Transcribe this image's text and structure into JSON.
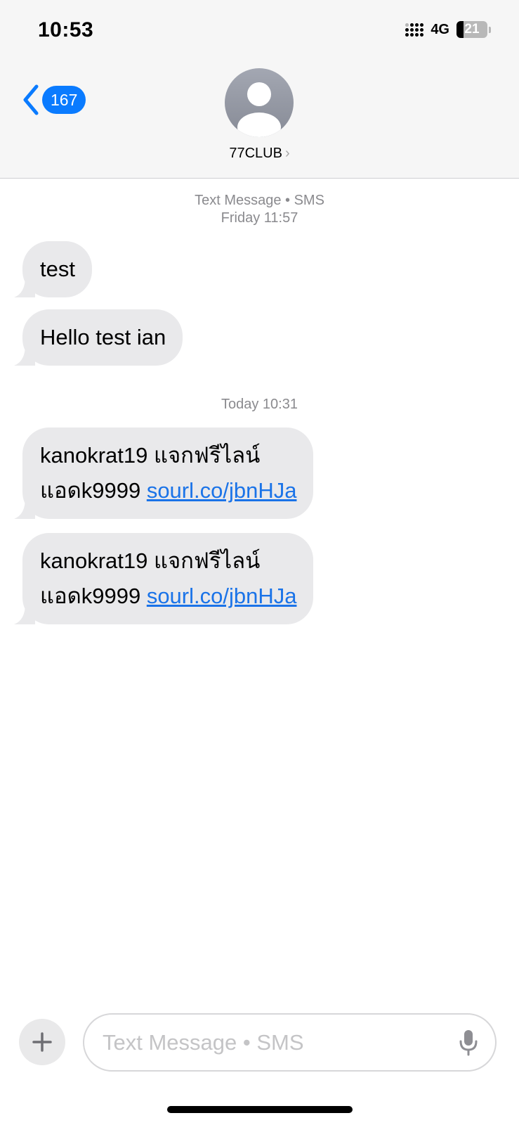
{
  "status_bar": {
    "time": "10:53",
    "network": "4G",
    "battery": "21",
    "battery_level": 0.21
  },
  "header": {
    "back_badge": "167",
    "contact_name": "77CLUB",
    "accent_color": "#0a7bff"
  },
  "thread": {
    "timestamp_1_line1": "Text Message • SMS",
    "timestamp_1_line2": "Friday 11:57",
    "timestamp_2": "Today 10:31",
    "messages": [
      {
        "text": "test"
      },
      {
        "text": "Hello test ian"
      },
      {
        "line1": "kanokrat19 แจกฟรีไลน์",
        "line2_prefix": "แอดk9999 ",
        "link": "sourl.co/jbnHJa"
      },
      {
        "line1": "kanokrat19 แจกฟรีไลน์",
        "line2_prefix": "แอดk9999 ",
        "link": "sourl.co/jbnHJa"
      }
    ]
  },
  "composer": {
    "placeholder": "Text Message • SMS",
    "add_icon": "plus-icon",
    "mic_icon": "microphone-icon"
  }
}
